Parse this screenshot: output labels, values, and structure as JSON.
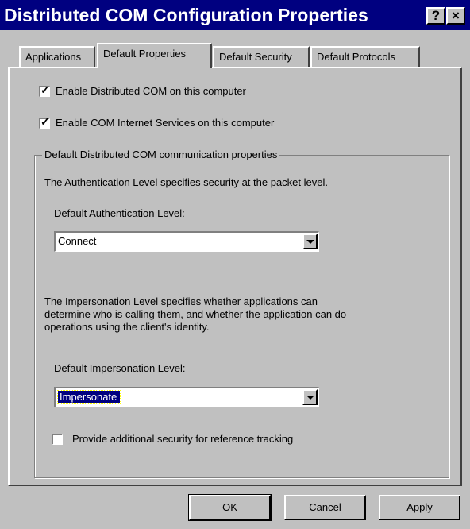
{
  "window": {
    "title": "Distributed COM Configuration Properties",
    "help_label": "?",
    "close_label": "×"
  },
  "tabs": [
    "Applications",
    "Default Properties",
    "Default Security",
    "Default Protocols"
  ],
  "checkboxes": {
    "enable_dcom": {
      "label": "Enable Distributed COM on this computer",
      "checked": true
    },
    "enable_cis": {
      "label": "Enable COM Internet Services on this computer",
      "checked": true
    }
  },
  "group": {
    "title": "Default Distributed COM communication properties",
    "auth_desc": "The Authentication Level specifies security at the packet level.",
    "auth_label": "Default Authentication Level:",
    "auth_value": "Connect",
    "imp_desc_1": "The Impersonation Level specifies whether applications can",
    "imp_desc_2": "determine who is calling them, and whether the application can do",
    "imp_desc_3": "operations using the client's identity.",
    "imp_label": "Default Impersonation Level:",
    "imp_value": "Impersonate",
    "ref_tracking_label": "Provide additional security for reference tracking",
    "ref_tracking_checked": false
  },
  "buttons": {
    "ok": "OK",
    "cancel": "Cancel",
    "apply": "Apply"
  }
}
